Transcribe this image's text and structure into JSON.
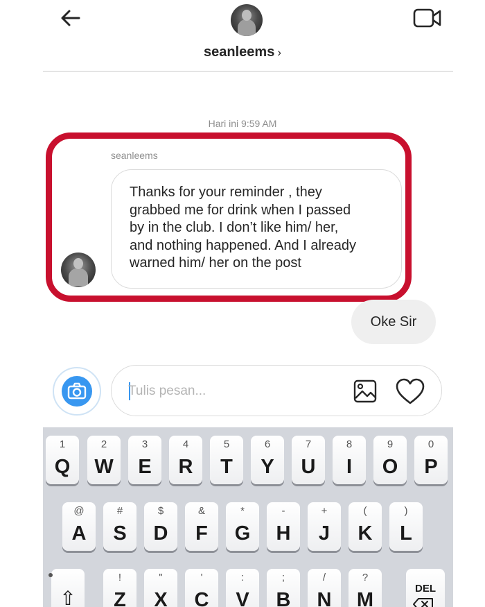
{
  "header": {
    "username": "seanleems",
    "chevron": "›",
    "icons": {
      "back": "arrow-left-icon",
      "video": "video-camera-icon",
      "avatar": "profile-avatar"
    }
  },
  "conversation": {
    "timestamp": "Hari ini 9:59 AM",
    "incoming": {
      "sender": "seanleems",
      "lines": [
        "Thanks for your reminder , they",
        "grabbed me for drink when I passed",
        "by in the club. I don’t like him/ her,",
        "and nothing happened. And I already",
        "warned him/ her on the post"
      ]
    },
    "outgoing": {
      "text": "Oke Sir"
    },
    "highlight_color": "#c8102e"
  },
  "composer": {
    "placeholder": "Tulis pesan...",
    "value": "",
    "icons": {
      "camera": "camera-icon",
      "gallery": "image-gallery-icon",
      "like": "heart-icon"
    },
    "accent": "#3897f0"
  },
  "keyboard": {
    "row1": [
      {
        "main": "Q",
        "sub": "1"
      },
      {
        "main": "W",
        "sub": "2"
      },
      {
        "main": "E",
        "sub": "3"
      },
      {
        "main": "R",
        "sub": "4"
      },
      {
        "main": "T",
        "sub": "5"
      },
      {
        "main": "Y",
        "sub": "6"
      },
      {
        "main": "U",
        "sub": "7"
      },
      {
        "main": "I",
        "sub": "8"
      },
      {
        "main": "O",
        "sub": "9"
      },
      {
        "main": "P",
        "sub": "0"
      }
    ],
    "row2": [
      {
        "main": "A",
        "sub": "@"
      },
      {
        "main": "S",
        "sub": "#"
      },
      {
        "main": "D",
        "sub": "$"
      },
      {
        "main": "F",
        "sub": "&"
      },
      {
        "main": "G",
        "sub": "*"
      },
      {
        "main": "H",
        "sub": "-"
      },
      {
        "main": "J",
        "sub": "+"
      },
      {
        "main": "K",
        "sub": "("
      },
      {
        "main": "L",
        "sub": ")"
      }
    ],
    "row3": [
      {
        "main": "Z",
        "sub": "!"
      },
      {
        "main": "X",
        "sub": "\""
      },
      {
        "main": "C",
        "sub": "'"
      },
      {
        "main": "V",
        "sub": ":"
      },
      {
        "main": "B",
        "sub": ";"
      },
      {
        "main": "N",
        "sub": "/"
      },
      {
        "main": "M",
        "sub": "?"
      }
    ],
    "shift_symbol": "⇧",
    "del_label": "DEL"
  }
}
